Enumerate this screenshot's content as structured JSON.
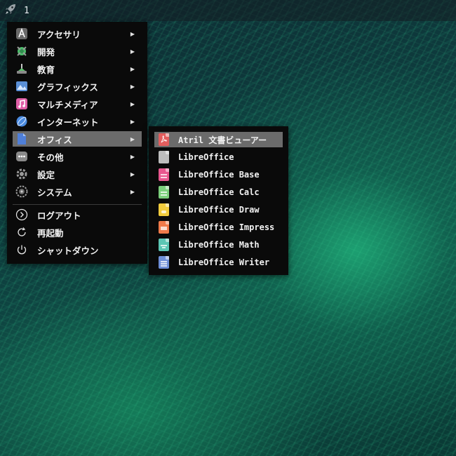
{
  "topbar": {
    "launcher_icon": "rocket-icon",
    "workspace": "1"
  },
  "main_menu": {
    "items": [
      {
        "label": "アクセサリ",
        "icon": "accessories-icon",
        "has_submenu": true
      },
      {
        "label": "開発",
        "icon": "development-icon",
        "has_submenu": true
      },
      {
        "label": "教育",
        "icon": "education-icon",
        "has_submenu": true
      },
      {
        "label": "グラフィックス",
        "icon": "graphics-icon",
        "has_submenu": true
      },
      {
        "label": "マルチメディア",
        "icon": "multimedia-icon",
        "has_submenu": true
      },
      {
        "label": "インターネット",
        "icon": "internet-icon",
        "has_submenu": true
      },
      {
        "label": "オフィス",
        "icon": "office-icon",
        "has_submenu": true,
        "active": true
      },
      {
        "label": "その他",
        "icon": "other-icon",
        "has_submenu": true
      },
      {
        "label": "設定",
        "icon": "settings-icon",
        "has_submenu": true
      },
      {
        "label": "システム",
        "icon": "system-icon",
        "has_submenu": true
      }
    ],
    "session": [
      {
        "label": "ログアウト",
        "icon": "logout-icon"
      },
      {
        "label": "再起動",
        "icon": "restart-icon"
      },
      {
        "label": "シャットダウン",
        "icon": "shutdown-icon"
      }
    ],
    "arrow_glyph": "▶"
  },
  "office_submenu": {
    "items": [
      {
        "label": "Atril 文書ビューアー",
        "icon": "pdf-viewer-icon",
        "color": "#e35d5d",
        "active": true
      },
      {
        "label": "LibreOffice",
        "icon": "libreoffice-icon",
        "color": "#bdbdbd"
      },
      {
        "label": "LibreOffice Base",
        "icon": "libreoffice-base-icon",
        "color": "#e9578f"
      },
      {
        "label": "LibreOffice Calc",
        "icon": "libreoffice-calc-icon",
        "color": "#7ccf7c"
      },
      {
        "label": "LibreOffice Draw",
        "icon": "libreoffice-draw-icon",
        "color": "#f2cc3d"
      },
      {
        "label": "LibreOffice Impress",
        "icon": "libreoffice-impress-icon",
        "color": "#f07a4a"
      },
      {
        "label": "LibreOffice Math",
        "icon": "libreoffice-math-icon",
        "color": "#5cc6b4"
      },
      {
        "label": "LibreOffice Writer",
        "icon": "libreoffice-writer-icon",
        "color": "#6f8fd8"
      }
    ]
  },
  "colors": {
    "menu_bg": "#0a0a0a",
    "active_bg": "#6b6b6b",
    "text": "#f2f2f2"
  }
}
